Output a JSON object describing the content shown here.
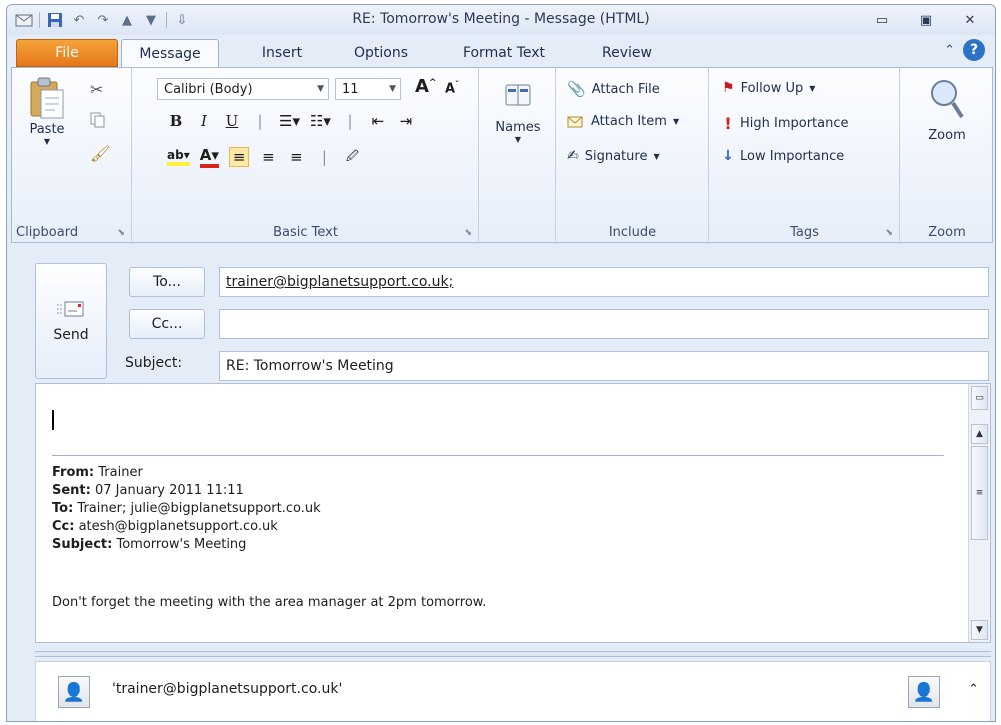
{
  "window": {
    "title": "RE: Tomorrow's Meeting  -  Message (HTML)"
  },
  "quick_access": {
    "icons": [
      "outlook-icon",
      "save-icon",
      "undo-icon",
      "redo-icon",
      "up-arrow-icon",
      "down-arrow-icon",
      "customize-icon"
    ]
  },
  "ribbon": {
    "tabs": [
      "File",
      "Message",
      "Insert",
      "Options",
      "Format Text",
      "Review"
    ],
    "active_tab": "Message",
    "clipboard": {
      "label": "Clipboard",
      "paste": "Paste"
    },
    "basic_text": {
      "label": "Basic Text",
      "font": "Calibri (Body)",
      "size": "11"
    },
    "names": {
      "label": "Names"
    },
    "include": {
      "label": "Include",
      "attach_file": "Attach File",
      "attach_item": "Attach Item",
      "signature": "Signature"
    },
    "tags": {
      "label": "Tags",
      "follow_up": "Follow Up",
      "high_importance": "High Importance",
      "low_importance": "Low Importance"
    },
    "zoom": {
      "label": "Zoom",
      "button": "Zoom"
    }
  },
  "compose": {
    "send": "Send",
    "to_button": "To...",
    "cc_button": "Cc...",
    "subject_label": "Subject:",
    "to_value": "trainer@bigplanetsupport.co.uk;",
    "cc_value": "",
    "subject_value": "RE: Tomorrow's Meeting"
  },
  "quoted": {
    "from_label": "From:",
    "from": "Trainer",
    "sent_label": "Sent:",
    "sent": "07 January 2011 11:11",
    "to_label": "To:",
    "to": "Trainer; julie@bigplanetsupport.co.uk",
    "cc_label": "Cc:",
    "cc": "atesh@bigplanetsupport.co.uk",
    "subject_label": "Subject:",
    "subject": "Tomorrow's Meeting",
    "message": "Don't forget the meeting with the area manager at 2pm tomorrow."
  },
  "people_pane": {
    "name": "'trainer@bigplanetsupport.co.uk'"
  }
}
